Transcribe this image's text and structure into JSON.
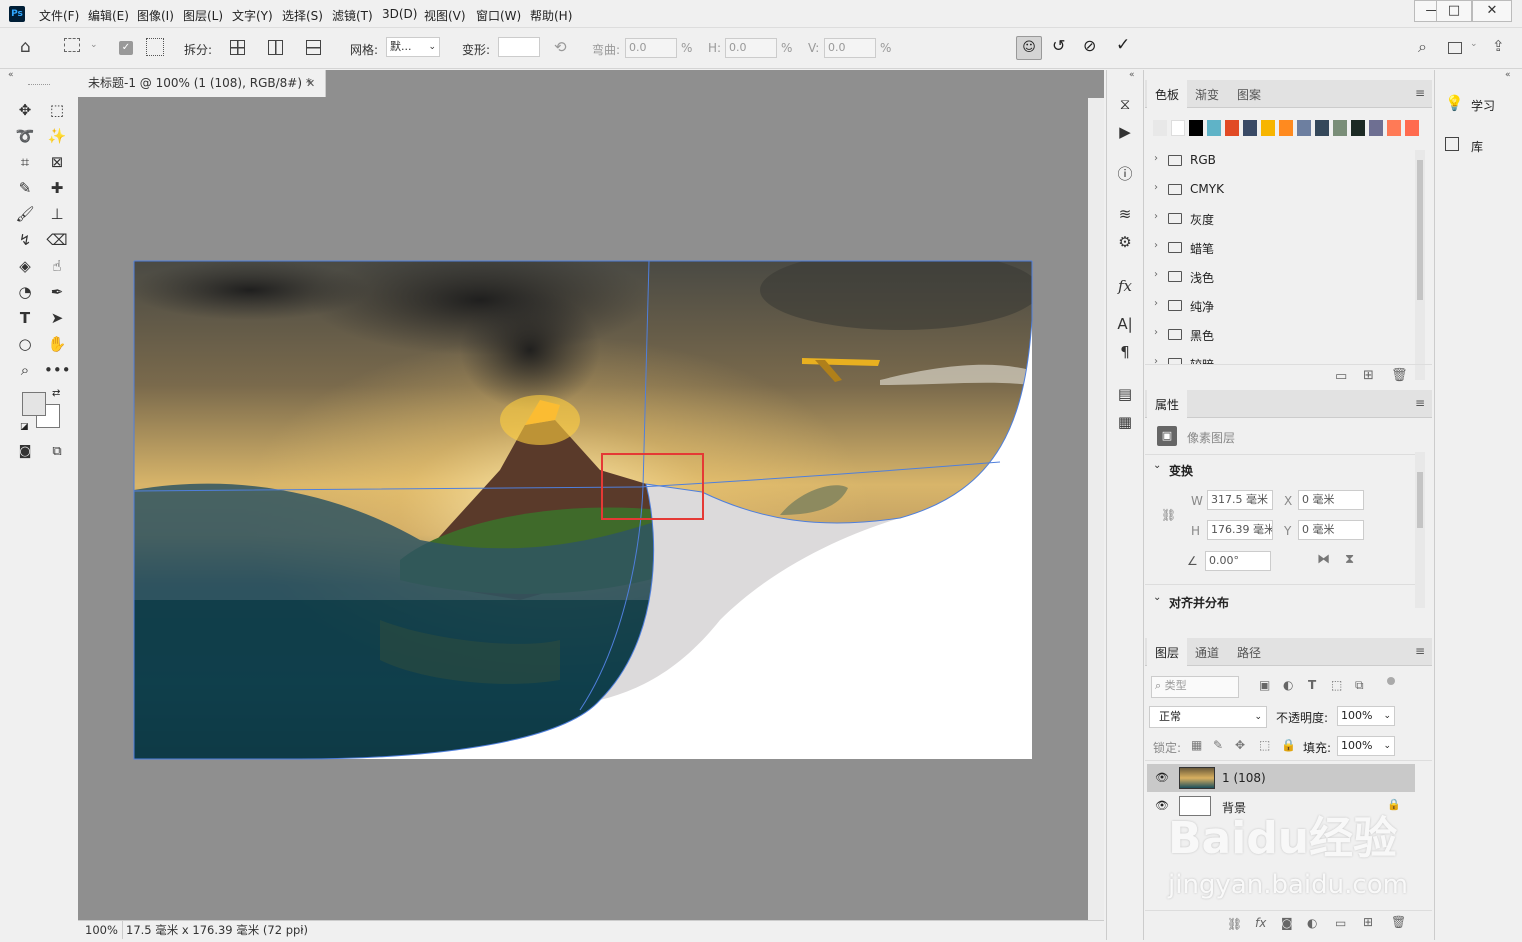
{
  "app": {
    "logo": "Ps"
  },
  "menu": [
    "文件(F)",
    "编辑(E)",
    "图像(I)",
    "图层(L)",
    "文字(Y)",
    "选择(S)",
    "滤镜(T)",
    "3D(D)",
    "视图(V)",
    "窗口(W)",
    "帮助(H)"
  ],
  "window": {
    "minimize": "—",
    "restore": "□",
    "close": "✕"
  },
  "options": {
    "split_label": "拆分:",
    "grid_label": "网格:",
    "grid_value": "默...",
    "warp_label": "变形:",
    "bend_label": "弯曲:",
    "bend_value": "0.0",
    "h_label": "H:",
    "h_value": "0.0",
    "v_label": "V:",
    "v_value": "0.0",
    "percent": "%"
  },
  "document": {
    "tab_title": "未标题-1 @ 100% (1 (108), RGB/8#) *",
    "zoom": "100%",
    "status_info": "17.5 毫米 x 176.39 毫米 (72 ppi)"
  },
  "swatches_panel": {
    "tabs": [
      "色板",
      "渐变",
      "图案"
    ],
    "colors": [
      "#e8e8e8",
      "#ffffff",
      "#000000",
      "#5fb3c7",
      "#e14a25",
      "#3a4a66",
      "#f7b500",
      "#ff8a1f",
      "#6d7fa0",
      "#35485a",
      "#7a8e78",
      "#1c2a24",
      "#6e6f92",
      "#ff7a56",
      "#ff6b4f"
    ],
    "groups": [
      "RGB",
      "CMYK",
      "灰度",
      "蜡笔",
      "浅色",
      "纯净",
      "黑色",
      "较暗"
    ]
  },
  "properties_panel": {
    "tab": "属性",
    "layer_type": "像素图层",
    "transform_title": "变换",
    "w_label": "W",
    "w_value": "317.5 毫米",
    "x_label": "X",
    "x_value": "0 毫米",
    "h_label": "H",
    "h_value": "176.39 毫米",
    "y_label": "Y",
    "y_value": "0 毫米",
    "angle_value": "0.00°",
    "align_title": "对齐并分布"
  },
  "layers_panel": {
    "tabs": [
      "图层",
      "通道",
      "路径"
    ],
    "filter_placeholder": "类型",
    "blend_mode": "正常",
    "opacity_label": "不透明度:",
    "opacity_value": "100%",
    "lock_label": "锁定:",
    "fill_label": "填充:",
    "fill_value": "100%",
    "layers": [
      {
        "name": "1 (108)",
        "selected": true
      },
      {
        "name": "背景",
        "locked": true
      }
    ]
  },
  "right_panel": {
    "learn": "学习",
    "library": "库"
  },
  "watermark": {
    "text1": "Baidu经验",
    "text2": "jingyan.baidu.com"
  }
}
